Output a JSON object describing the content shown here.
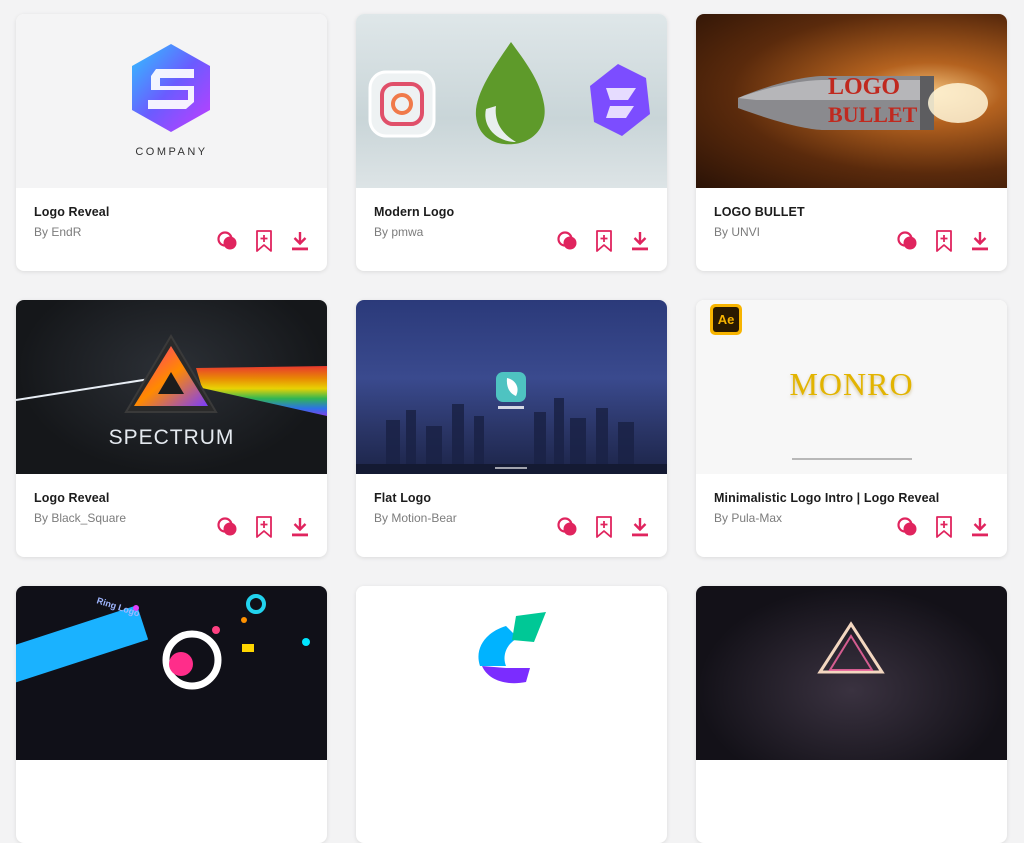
{
  "theme": {
    "accent": "#e0245e",
    "card_bg": "#ffffff",
    "page_bg": "#f3f3f4"
  },
  "actions": {
    "icons": [
      "overlap-circles-icon",
      "bookmark-add-icon",
      "download-icon"
    ]
  },
  "cards": [
    {
      "title": "Logo Reveal",
      "author": "By EndR",
      "thumb_text": "COMPANY"
    },
    {
      "title": "Modern Logo",
      "author": "By pmwa"
    },
    {
      "title": "LOGO BULLET",
      "author": "By UNVI",
      "thumb_text_1": "LOGO",
      "thumb_text_2": "BULLET"
    },
    {
      "title": "Logo Reveal",
      "author": "By Black_Square",
      "thumb_text": "SPECTRUM"
    },
    {
      "title": "Flat Logo",
      "author": "By Motion-Bear"
    },
    {
      "title": "Minimalistic Logo Intro | Logo Reveal",
      "author": "By Pula-Max",
      "badge": "Ae",
      "thumb_text": "MONRO"
    },
    {
      "thumb_text": "Ring Logo"
    },
    {},
    {}
  ]
}
